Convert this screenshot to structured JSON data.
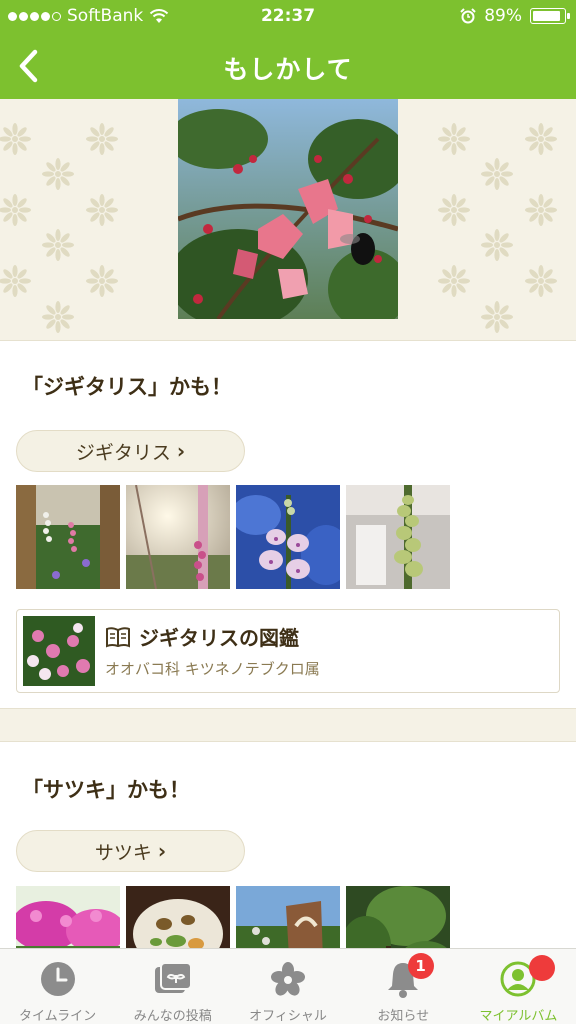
{
  "status_bar": {
    "carrier": "SoftBank",
    "time": "22:37",
    "battery": "89%",
    "battery_level": 0.89,
    "signal_bars_filled": 4
  },
  "nav": {
    "title": "もしかして",
    "back_icon": "chevron-left-icon"
  },
  "suggestions": [
    {
      "heading": "「ジギタリス」かも！",
      "pill_label": "ジギタリス",
      "zukan": {
        "title": "ジギタリスの図鑑",
        "subtitle": "オオバコ科 キツネノテブクロ属",
        "icon": "book-icon"
      }
    },
    {
      "heading": "「サツキ」かも！",
      "pill_label": "サツキ"
    }
  ],
  "tabs": [
    {
      "label": "タイムライン",
      "icon": "clock-icon"
    },
    {
      "label": "みんなの投稿",
      "icon": "photos-icon"
    },
    {
      "label": "オフィシャル",
      "icon": "flower-icon"
    },
    {
      "label": "お知らせ",
      "icon": "bell-icon",
      "badge": "1"
    },
    {
      "label": "マイアルバム",
      "icon": "user-icon",
      "active": true
    }
  ],
  "colors": {
    "brand_green": "#7dc12f",
    "badge_red": "#ee3b3b",
    "cream_bg": "#f5f2e6"
  }
}
